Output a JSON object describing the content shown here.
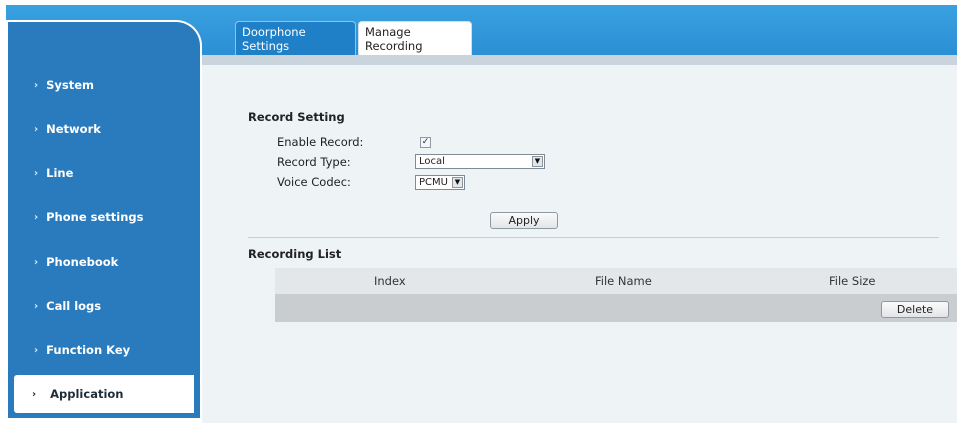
{
  "tabs": [
    {
      "label": "Doorphone Settings"
    },
    {
      "label": "Manage Recording"
    }
  ],
  "sidebar": {
    "items": [
      {
        "label": "System"
      },
      {
        "label": "Network"
      },
      {
        "label": "Line"
      },
      {
        "label": "Phone settings"
      },
      {
        "label": "Phonebook"
      },
      {
        "label": "Call logs"
      },
      {
        "label": "Function Key"
      },
      {
        "label": "Application"
      }
    ],
    "active": "Application",
    "chevron": "›"
  },
  "record_setting": {
    "title": "Record Setting",
    "enable_record_label": "Enable Record:",
    "enable_record_checked": true,
    "checkmark": "✓",
    "record_type_label": "Record Type:",
    "record_type_value": "Local",
    "voice_codec_label": "Voice Codec:",
    "voice_codec_value": "PCMU",
    "apply_label": "Apply"
  },
  "recording_list": {
    "title": "Recording List",
    "columns": [
      "Index",
      "File Name",
      "File Size"
    ],
    "delete_label": "Delete"
  },
  "colors": {
    "sidebar_bg": "#2a7bbd",
    "topbar_bg": "#2b8fd4",
    "active_tab_bg": "#1f80c8",
    "content_bg": "#eef4f6"
  }
}
